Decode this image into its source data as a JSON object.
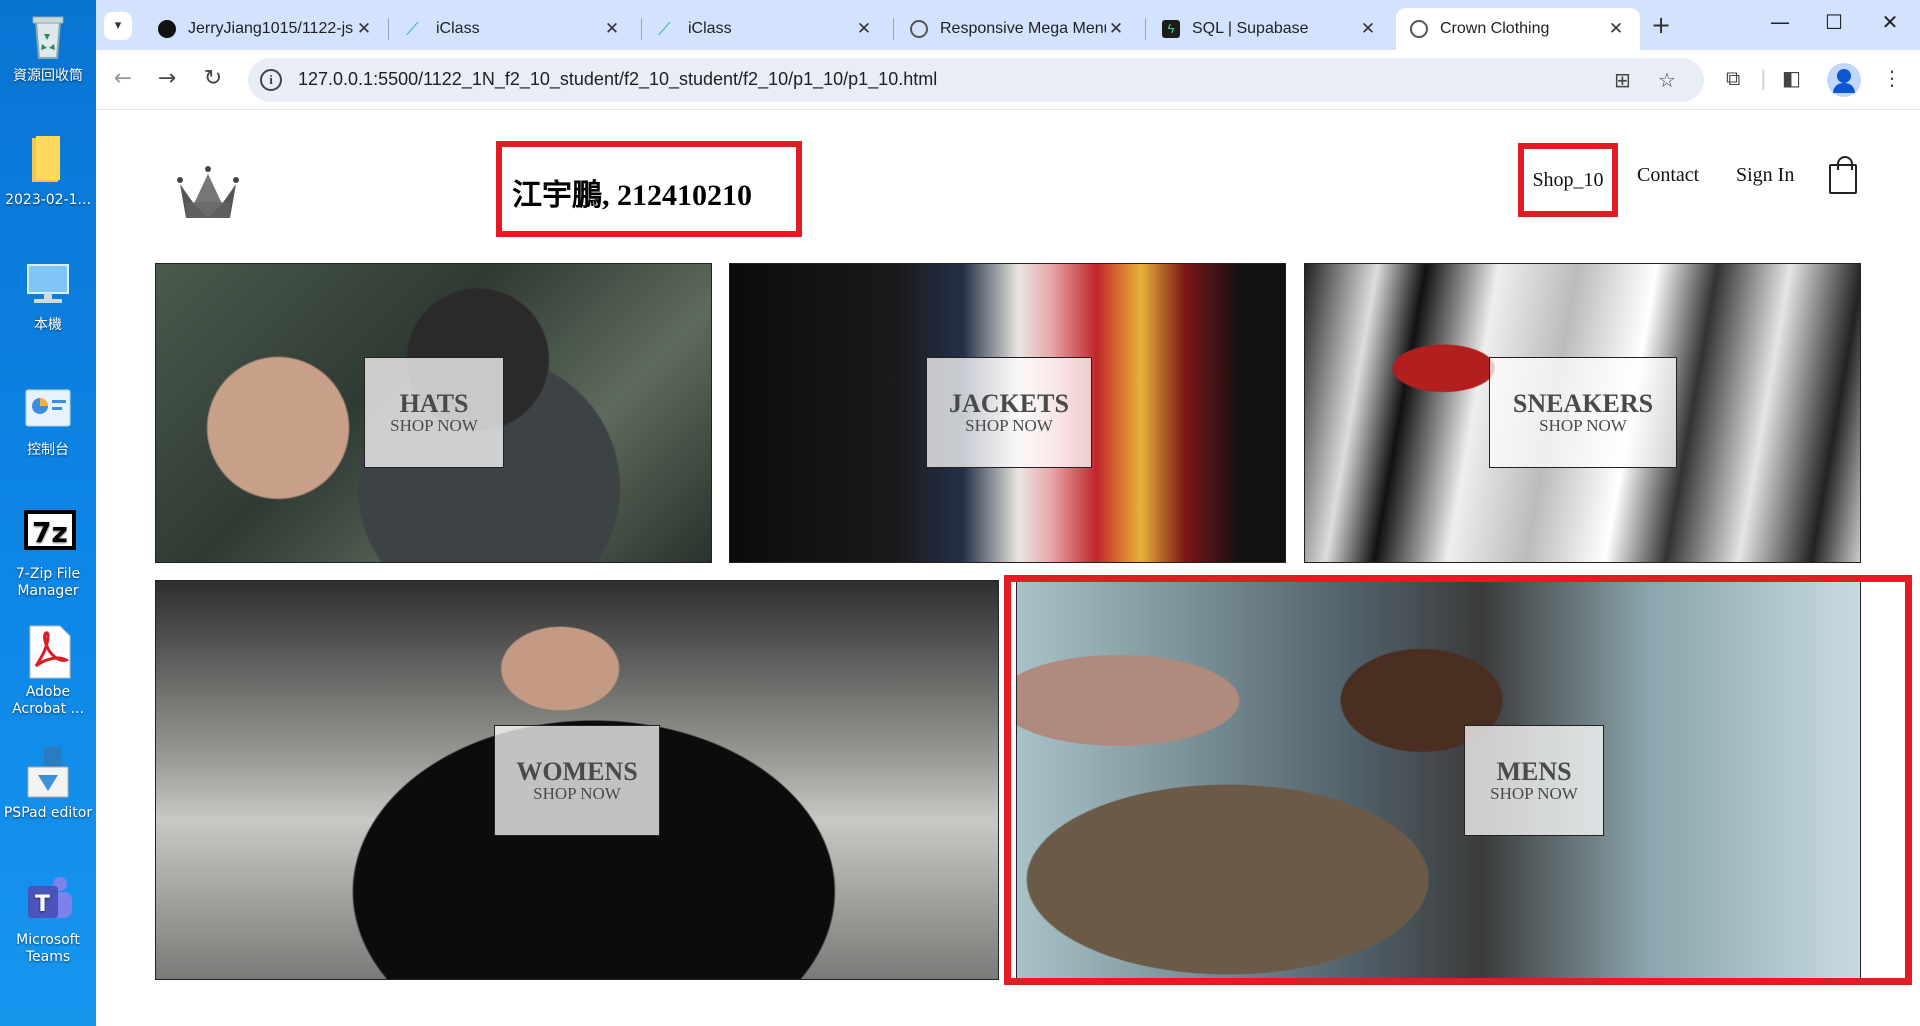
{
  "desktop": {
    "icons": [
      {
        "label": "資源回收筒",
        "icon": "recycle-bin-icon"
      },
      {
        "label": "2023-02-1...",
        "icon": "folder-icon"
      },
      {
        "label": "本機",
        "icon": "computer-icon"
      },
      {
        "label": "控制台",
        "icon": "control-panel-icon"
      },
      {
        "label": "7-Zip File Manager",
        "icon": "7zip-icon"
      },
      {
        "label": "Adobe Acrobat ...",
        "icon": "acrobat-icon"
      },
      {
        "label": "PSPad editor",
        "icon": "pspad-icon"
      },
      {
        "label": "Microsoft Teams",
        "icon": "teams-icon"
      }
    ]
  },
  "browser": {
    "tabs": [
      {
        "title": "JerryJiang1015/1122-js",
        "icon": "github-icon"
      },
      {
        "title": "iClass",
        "icon": "iclass-icon"
      },
      {
        "title": "iClass",
        "icon": "iclass-icon"
      },
      {
        "title": "Responsive Mega Menu",
        "icon": "globe-icon"
      },
      {
        "title": "SQL | Supabase",
        "icon": "supabase-icon"
      },
      {
        "title": "Crown Clothing",
        "icon": "globe-icon"
      }
    ],
    "url": "127.0.0.1:5500/1122_1N_f2_10_student/f2_10_student/f2_10/p1_10/p1_10.html"
  },
  "site": {
    "student_name": "江宇鵬, 212410210",
    "nav": {
      "shop": "Shop_10",
      "contact": "Contact",
      "signin": "Sign In"
    },
    "categories": [
      {
        "title": "HATS",
        "cta": "SHOP NOW"
      },
      {
        "title": "JACKETS",
        "cta": "SHOP NOW"
      },
      {
        "title": "SNEAKERS",
        "cta": "SHOP NOW"
      },
      {
        "title": "WOMENS",
        "cta": "SHOP NOW"
      },
      {
        "title": "MENS",
        "cta": "SHOP NOW"
      }
    ]
  },
  "colors": {
    "highlight": "#e31b23",
    "tab_strip": "#d3e3fd",
    "desktop": "#0b78d7"
  }
}
